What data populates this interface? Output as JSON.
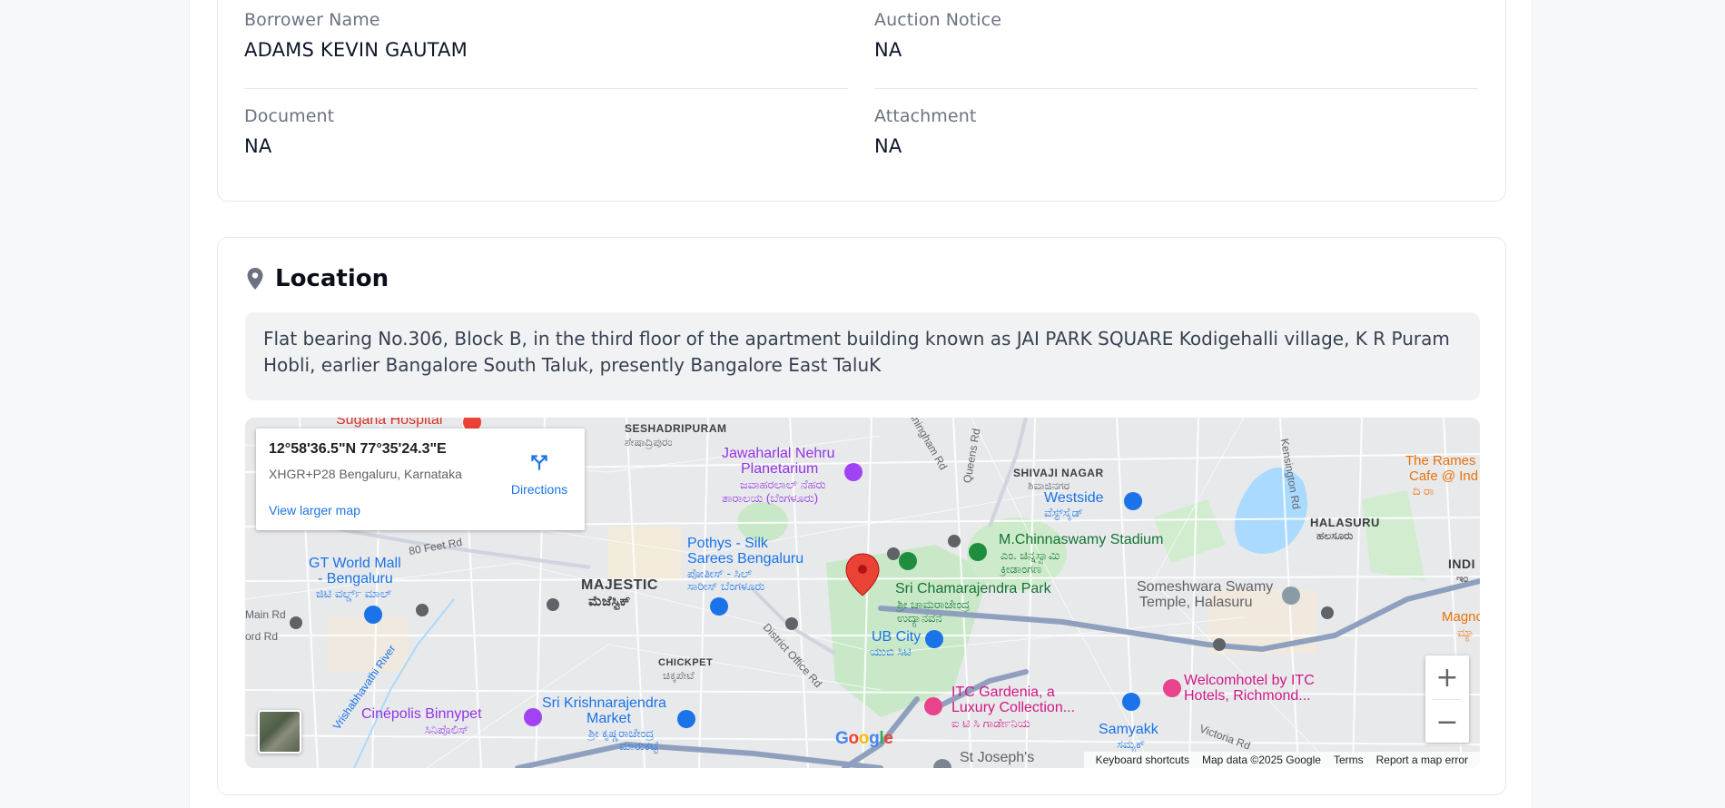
{
  "details": {
    "fields": [
      {
        "label": "Borrower Name",
        "value": "ADAMS KEVIN GAUTAM"
      },
      {
        "label": "Auction Notice",
        "value": "NA"
      },
      {
        "label": "Document",
        "value": "NA"
      },
      {
        "label": "Attachment",
        "value": "NA"
      }
    ]
  },
  "location": {
    "title": "Location",
    "address": "Flat bearing No.306, Block B, in the third floor of the apartment building known as JAI PARK SQUARE Kodigehalli village, K R Puram Hobli, earlier Bangalore South Taluk, presently Bangalore East TaluK"
  },
  "map": {
    "infobox": {
      "coords": "12°58'36.5\"N 77°35'24.3\"E",
      "plus_code": "XHGR+P28 Bengaluru, Karnataka",
      "directions": "Directions",
      "larger_map": "View larger map"
    },
    "labels": {
      "seshadripuram": "SESHADRIPURAM",
      "seshadripuram_kn": "ಶೇಷಾದ್ರಿಪುರಂ",
      "jawaharlal": "Jawaharlal Nehru",
      "planetarium": "Planetarium",
      "jawaharlal_kn1": "ಜವಾಹರಲಾಲ್ ನೆಹರು",
      "jawaharlal_kn2": "ತಾರಾಲಯ (ಬೆಂಗಳೂರು)",
      "shivaji": "SHIVAJI NAGAR",
      "shivaji_kn": "ಶಿವಾಜಿನಗರ",
      "westside": "Westside",
      "westside_kn": "ವೆಸ್ಟ್‌ಸೈಡ್",
      "halasuru": "HALASURU",
      "halasuru_kn": "ಹಲಸೂರು",
      "rameshwaram1": "The Rames",
      "rameshwaram2": "Cafe @ Ind",
      "rameshwaram3": "ದಿ ರಾ",
      "stadium": "M.Chinnaswamy Stadium",
      "stadium_kn1": "ಎಂ. ಚಿನ್ನಸ್ವಾಮಿ",
      "stadium_kn2": "ಕ್ರೀಡಾಂಗಣ",
      "pothys1": "Pothys - Silk",
      "pothys2": "Sarees Bengaluru",
      "pothys_kn1": "ಪೋತೀಸ್ - ಸಿಲ್",
      "pothys_kn2": "ಸಾರೀಸ್ ಬೆಂಗಳೂರು",
      "gtmall1": "GT World Mall",
      "gtmall2": "- Bengaluru",
      "gtmall_kn": "ಜಿಟಿ ವರ್ಲ್ಡ್ ಮಾಲ್",
      "majestic": "MAJESTIC",
      "majestic_kn": "ಮೆಜೆಸ್ಟಿಕ್",
      "park": "Sri Chamarajendra Park",
      "park_kn1": "ಶ್ರೀ ಚಾಮರಾಜೇಂದ್ರ",
      "park_kn2": "ಉದ್ಯಾನವನ",
      "someshwara1": "Someshwara Swamy",
      "someshwara2": "Temple, Halasuru",
      "ubcity": "UB City",
      "ubcity_kn": "ಯುಬಿ ಸಿಟಿ",
      "chickpet": "CHICKPET",
      "chickpet_kn": "ಚಿಕ್ಕಪೇಟೆ",
      "itc1": "ITC Gardenia, a",
      "itc2": "Luxury Collection...",
      "itc_kn": "ಐ ಟಿ ಸಿ ಗಾರ್ಡೇನಿಯ",
      "welcom1": "Welcomhotel by ITC",
      "welcom2": "Hotels, Richmond...",
      "krmarket1": "Sri Krishnarajendra",
      "krmarket2": "Market",
      "krmarket_kn1": "ಶ್ರೀ ಕೃಷ್ಣರಾಜೇಂದ್ರ",
      "krmarket_kn2": "ಮಾರುಕಟ್ಟೆ",
      "cinepolis": "Cinépolis Binnypet",
      "cinepolis_kn": "ಸಿನಿಪೊಲಿಸ್",
      "samyakk": "Samyakk",
      "samyakk_kn": "ಸಮ್ಯಕ್",
      "magnoli1": "Magnoli",
      "magnoli2": "ಮ್ಯಾ",
      "stjoseph": "St Joseph's",
      "indi": "INDI",
      "indi_kn": "ಇಂ",
      "sugana": "Sugana Hospital",
      "road_80ft": "80 Feet Rd",
      "road_vrishabhavathi": "Vrishabhavathi River",
      "road_district": "District Office Rd",
      "road_queens": "Queens Rd",
      "road_kensington": "Kensington Rd",
      "road_victoria": "Victoria Rd",
      "road_cunningham": "Cunningham Rd",
      "road_main": "Main Rd",
      "road_ord": "ord Rd"
    },
    "google": "Google",
    "footer": {
      "shortcuts": "Keyboard shortcuts",
      "mapdata": "Map data ©2025 Google",
      "terms": "Terms",
      "report": "Report a map error"
    },
    "zoom_in": "+",
    "zoom_out": "−"
  }
}
